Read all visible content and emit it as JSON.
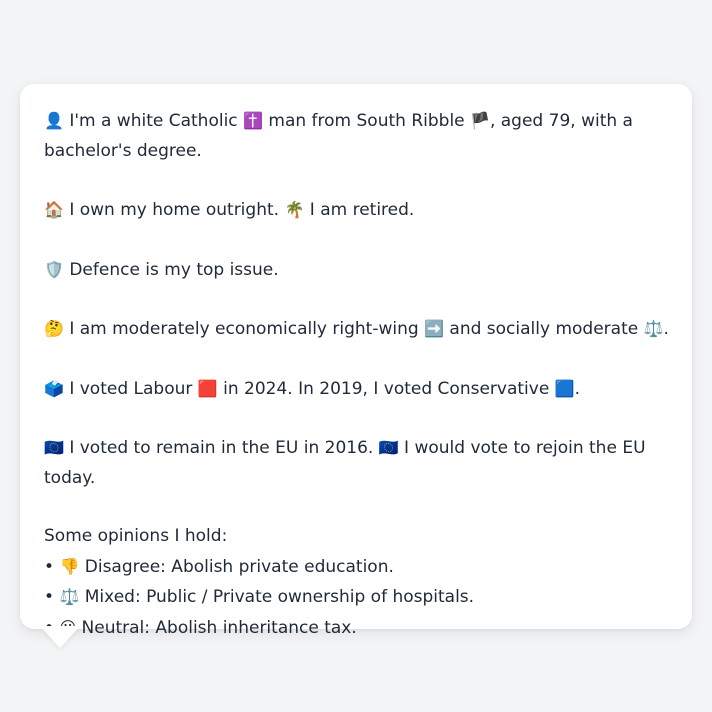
{
  "intro": {
    "icon": "👤",
    "text_a": "I'm a white Catholic",
    "icon_religion": "✝️",
    "text_b": "man from South Ribble",
    "icon_flag": "🏴",
    "text_c": ", aged 79, with a bachelor's degree."
  },
  "housing": {
    "icon_home": "🏠",
    "text_home": "I own my home outright.",
    "icon_retired": "🌴",
    "text_retired": "I am retired."
  },
  "issue": {
    "icon": "🛡️",
    "text": "Defence is my top issue."
  },
  "ideology": {
    "icon": "🤔",
    "text_a": "I am moderately economically right-wing",
    "icon_right": "➡️",
    "text_b": "and socially moderate",
    "icon_scale": "⚖️",
    "text_c": "."
  },
  "votes": {
    "icon": "🗳️",
    "text_a": "I voted Labour",
    "icon_labour": "🟥",
    "text_b": "in 2024. In 2019, I voted Conservative",
    "icon_conservative": "🟦",
    "text_c": "."
  },
  "eu": {
    "icon_a": "🇪🇺",
    "text_a": "I voted to remain in the EU in 2016.",
    "icon_b": "🇪🇺",
    "text_b": "I would vote to rejoin the EU today."
  },
  "opinions": {
    "heading": "Some opinions I hold:",
    "items": [
      {
        "bullet": "•",
        "icon": "👎",
        "text": "Disagree: Abolish private education."
      },
      {
        "bullet": "•",
        "icon": "⚖️",
        "text": "Mixed: Public / Private ownership of hospitals."
      },
      {
        "bullet": "•",
        "icon": "😐",
        "text": "Neutral: Abolish inheritance tax."
      }
    ]
  }
}
